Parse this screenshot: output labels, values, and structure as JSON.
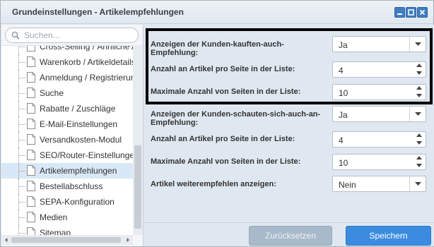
{
  "window": {
    "title": "Grundeinstellungen - Artikelempfehlungen",
    "controls": [
      "minimize-icon",
      "maximize-icon",
      "close-icon"
    ]
  },
  "sidebar": {
    "search_placeholder": "Suchen...",
    "items": [
      {
        "label": "Cross-Selling / Ähnliche Ar",
        "icon": "document-icon"
      },
      {
        "label": "Warenkorb / Artikeldetails",
        "icon": "document-icon"
      },
      {
        "label": "Anmeldung / Registrierung",
        "icon": "document-icon"
      },
      {
        "label": "Suche",
        "icon": "document-icon"
      },
      {
        "label": "Rabatte / Zuschläge",
        "icon": "document-icon"
      },
      {
        "label": "E-Mail-Einstellungen",
        "icon": "document-icon"
      },
      {
        "label": "Versandkosten-Modul",
        "icon": "document-icon"
      },
      {
        "label": "SEO/Router-Einstellungen",
        "icon": "document-icon"
      },
      {
        "label": "Artikelempfehlungen",
        "icon": "document-icon",
        "selected": true
      },
      {
        "label": "Bestellabschluss",
        "icon": "document-icon"
      },
      {
        "label": "SEPA-Konfiguration",
        "icon": "document-icon"
      },
      {
        "label": "Medien",
        "icon": "document-icon"
      },
      {
        "label": "Sitemap",
        "icon": "document-icon"
      }
    ]
  },
  "form": {
    "fields": [
      {
        "label": "Anzeigen der Kunden-kauften-auch-Empfehlung:",
        "type": "combo",
        "value": "Ja"
      },
      {
        "label": "Anzahl an Artikel pro Seite in der Liste:",
        "type": "spinner",
        "value": "4"
      },
      {
        "label": "Maximale Anzahl von Seiten in der Liste:",
        "type": "spinner",
        "value": "10"
      },
      {
        "label": "Anzeigen der Kunden-schauten-sich-auch-an-Empfehlung:",
        "type": "combo",
        "value": "Ja"
      },
      {
        "label": "Anzahl an Artikel pro Seite in der Liste:",
        "type": "spinner",
        "value": "4"
      },
      {
        "label": "Maximale Anzahl von Seiten in der Liste:",
        "type": "spinner",
        "value": "10"
      },
      {
        "label": "Artikel weiterempfehlen anzeigen:",
        "type": "combo",
        "value": "Nein"
      }
    ]
  },
  "footer": {
    "reset_label": "Zurücksetzen",
    "save_label": "Speichern"
  },
  "colors": {
    "accent": "#3b8ce0",
    "disabled_button": "#a8b9ca",
    "highlight_frame": "#000000",
    "selected_item": "#d9e8f6"
  }
}
